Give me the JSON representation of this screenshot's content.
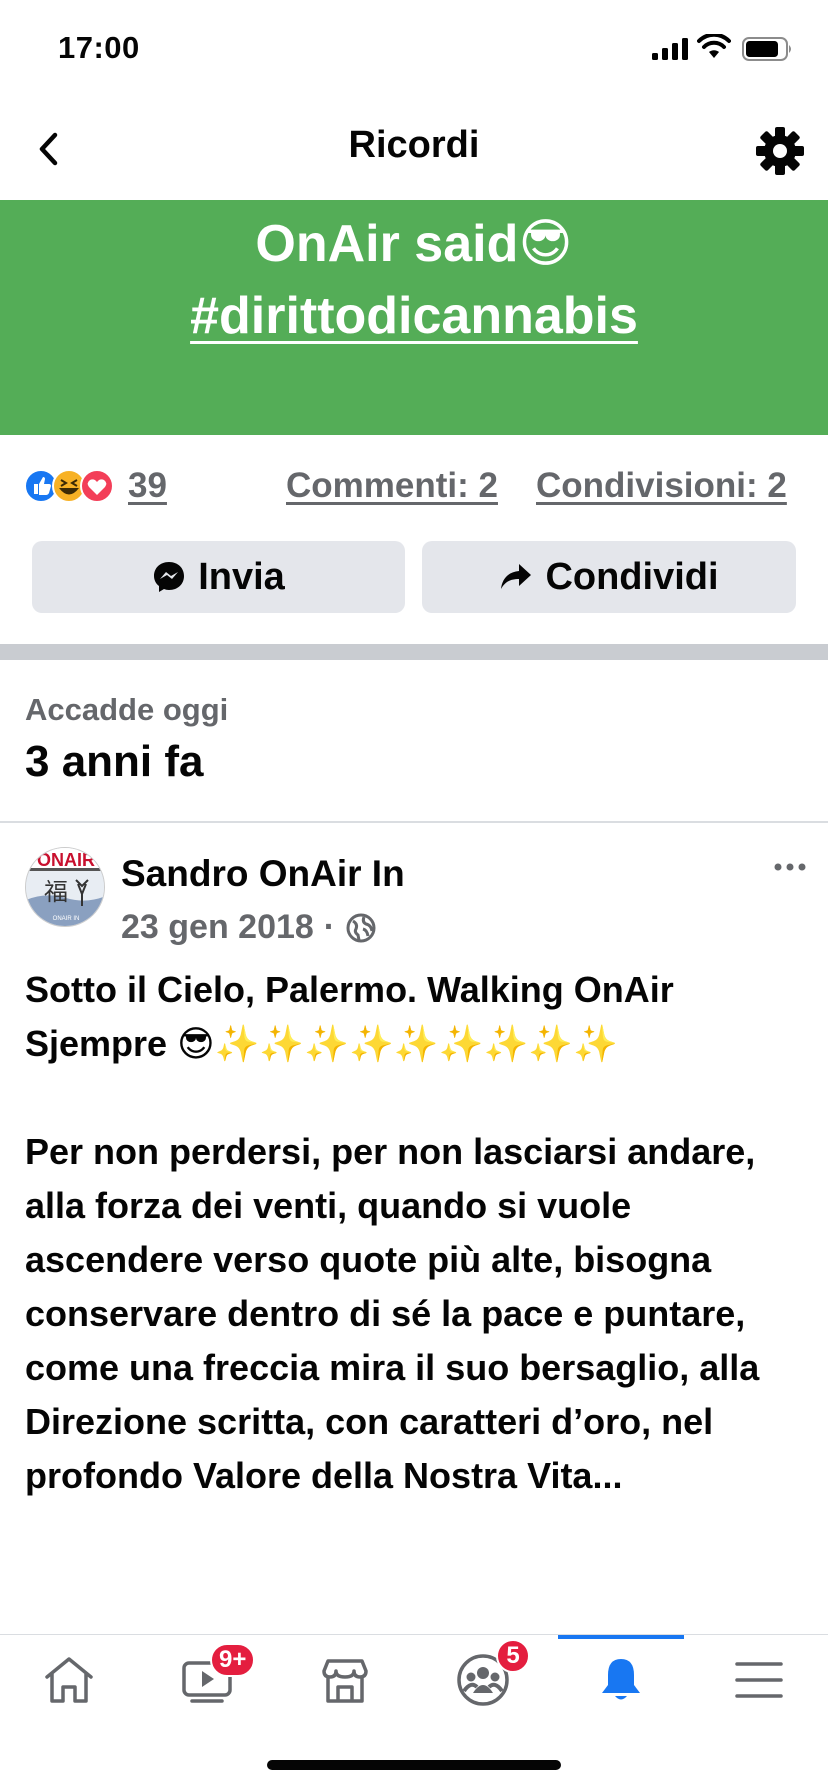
{
  "status_bar": {
    "time": "17:00"
  },
  "header": {
    "title": "Ricordi"
  },
  "green_post": {
    "line1_text": "OnAir said",
    "line1_emoji": "😎",
    "hashtag": "#dirittodicannabis"
  },
  "reactions": {
    "count": "39",
    "comments": "Commenti: 2",
    "shares": "Condivisioni: 2"
  },
  "actions": {
    "send": "Invia",
    "share": "Condividi"
  },
  "memory": {
    "label": "Accadde oggi",
    "years": "3 anni fa"
  },
  "post": {
    "author": "Sandro OnAir In",
    "date": "23 gen 2018",
    "dot": "·",
    "line1": "Sotto il Cielo, Palermo. Walking OnAir",
    "line2": "Sjempre 😎✨✨✨✨✨✨✨✨✨",
    "body": "Per non perdersi, per non lasciarsi andare, alla forza dei venti, quando si vuole ascendere verso quote più alte, bisogna conservare dentro di sé la pace e puntare, come una freccia mira il suo bersaglio, alla Direzione scritta, con caratteri d’oro, nel profondo Valore della Nostra Vita..."
  },
  "bottom_nav": {
    "watch_badge": "9+",
    "groups_badge": "5"
  },
  "colors": {
    "green_post_bg": "#54ad57",
    "accent_blue": "#1877f2",
    "badge_red": "#e41e3f",
    "secondary_text": "#65676b"
  }
}
